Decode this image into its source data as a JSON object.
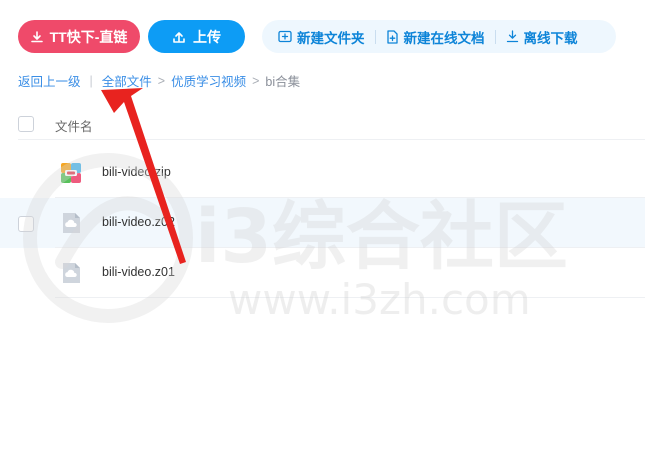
{
  "toolbar": {
    "primary_button": "TT快下-直链",
    "upload_button": "上传",
    "actions": [
      {
        "label": "新建文件夹",
        "icon": "folder-plus-icon"
      },
      {
        "label": "新建在线文档",
        "icon": "document-plus-icon"
      },
      {
        "label": "离线下载",
        "icon": "download-icon"
      }
    ]
  },
  "breadcrumb": {
    "back": "返回上一级",
    "separator": "|",
    "path": [
      "全部文件",
      "优质学习视频"
    ],
    "arrow": ">",
    "current": "bi合集"
  },
  "table": {
    "column_name": "文件名",
    "rows": [
      {
        "name": "bili-video.zip",
        "icon": "archive-file-icon"
      },
      {
        "name": "bili-video.z02",
        "icon": "unknown-file-icon"
      },
      {
        "name": "bili-video.z01",
        "icon": "unknown-file-icon"
      }
    ]
  },
  "watermark": {
    "title": "i3综合社区",
    "url": "www.i3zh.com"
  },
  "colors": {
    "primary_red": "#ef4a6a",
    "primary_blue": "#0d9cf5",
    "link_blue": "#3a8ee6",
    "annotation_arrow": "#e8231f"
  }
}
